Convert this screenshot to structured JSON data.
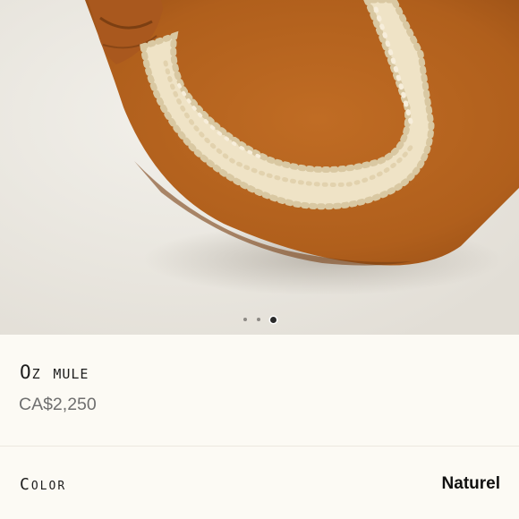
{
  "carousel": {
    "slides": [
      {
        "label": "image-1",
        "active": false
      },
      {
        "label": "image-2",
        "active": false
      },
      {
        "label": "image-3",
        "active": true
      }
    ]
  },
  "product": {
    "name": "Oz mule",
    "price": "CA$2,250"
  },
  "color": {
    "label": "Color",
    "value": "Naturel"
  },
  "colors": {
    "background": "#fcfaf4",
    "suede": "#b5651f",
    "shearling": "#efe3c6"
  }
}
